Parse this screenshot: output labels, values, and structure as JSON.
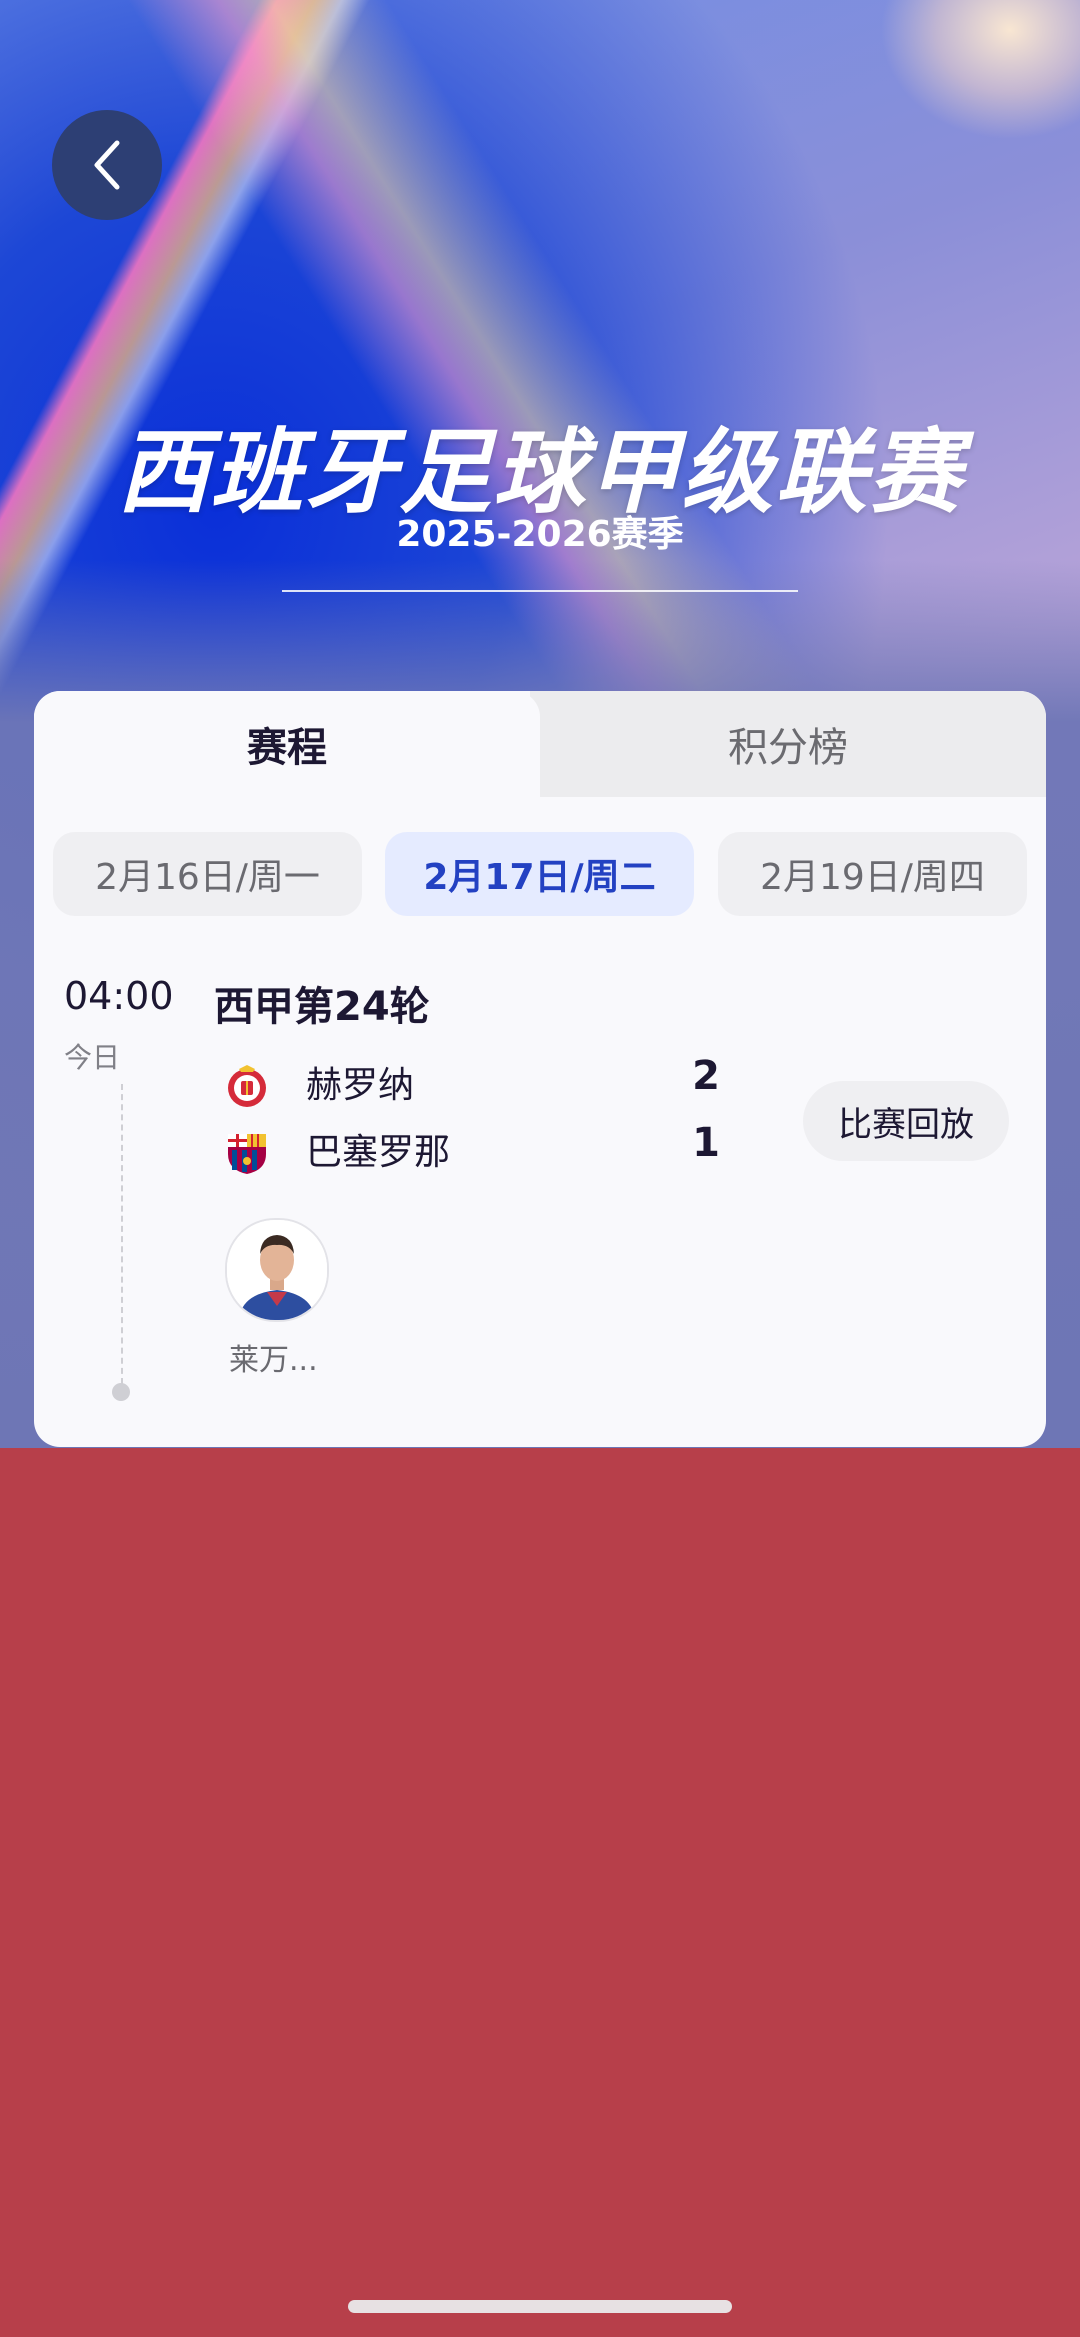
{
  "header": {
    "title": "西班牙足球甲级联赛",
    "season": "2025-2026赛季",
    "back_icon": "chevron-left-icon"
  },
  "tabs": [
    {
      "label": "赛程",
      "selected": true
    },
    {
      "label": "积分榜",
      "selected": false
    }
  ],
  "dates": [
    {
      "label": "2月16日/周一",
      "selected": false
    },
    {
      "label": "2月17日/周二",
      "selected": true
    },
    {
      "label": "2月19日/周四",
      "selected": false
    }
  ],
  "match": {
    "time": "04:00",
    "day": "今日",
    "round": "西甲第24轮",
    "home": {
      "name": "赫罗纳",
      "score": "2",
      "logo_icon": "girona-crest-icon"
    },
    "away": {
      "name": "巴塞罗那",
      "score": "1",
      "logo_icon": "barcelona-crest-icon"
    },
    "replay_label": "比赛回放",
    "player": {
      "name": "莱万...",
      "avatar_icon": "player-avatar-icon"
    }
  },
  "colors": {
    "accent": "#2341c2",
    "bottom_background": "#b73f4a",
    "back_button": "#2d3f74"
  }
}
